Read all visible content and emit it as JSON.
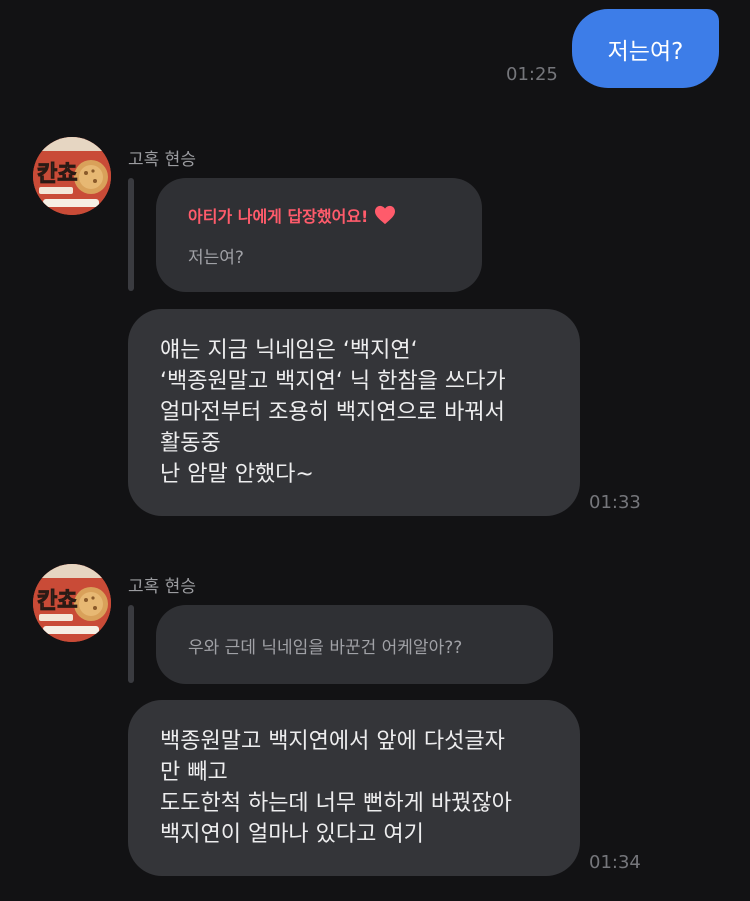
{
  "outgoing": {
    "text": "저는여?",
    "time": "01:25"
  },
  "group1": {
    "sender": "고혹 현승",
    "avatar_icon": "choco-snack-avatar-icon",
    "reply": {
      "header": "아티가 나에게 답장했어요!",
      "header_icon": "heart-icon",
      "header_color": "#ff5b6b",
      "quoted": "저는여?"
    },
    "message_lines": [
      "얘는 지금 닉네임은 ‘백지연‘",
      "‘백종원말고 백지연‘ 닉 한참을 쓰다가",
      "얼마전부터 조용히 백지연으로 바꿔서",
      "활동중",
      "난 암말 안했다~"
    ],
    "time": "01:33"
  },
  "group2": {
    "sender": "고혹 현승",
    "avatar_icon": "choco-snack-avatar-icon",
    "reply": {
      "quoted": "우와 근데 닉네임을 바꾼건 어케알아??"
    },
    "message_lines": [
      "백종원말고 백지연에서 앞에 다섯글자",
      "만 빼고",
      "도도한척 하는데 너무 뻔하게 바꿨잖아",
      "백지연이 얼마나 있다고 여기"
    ],
    "time": "01:34"
  },
  "colors": {
    "background": "#121214",
    "outgoing_bubble": "#3d7de8",
    "incoming_bubble": "#343539",
    "quote_bubble": "#2f3034",
    "timestamp": "#75767b"
  }
}
